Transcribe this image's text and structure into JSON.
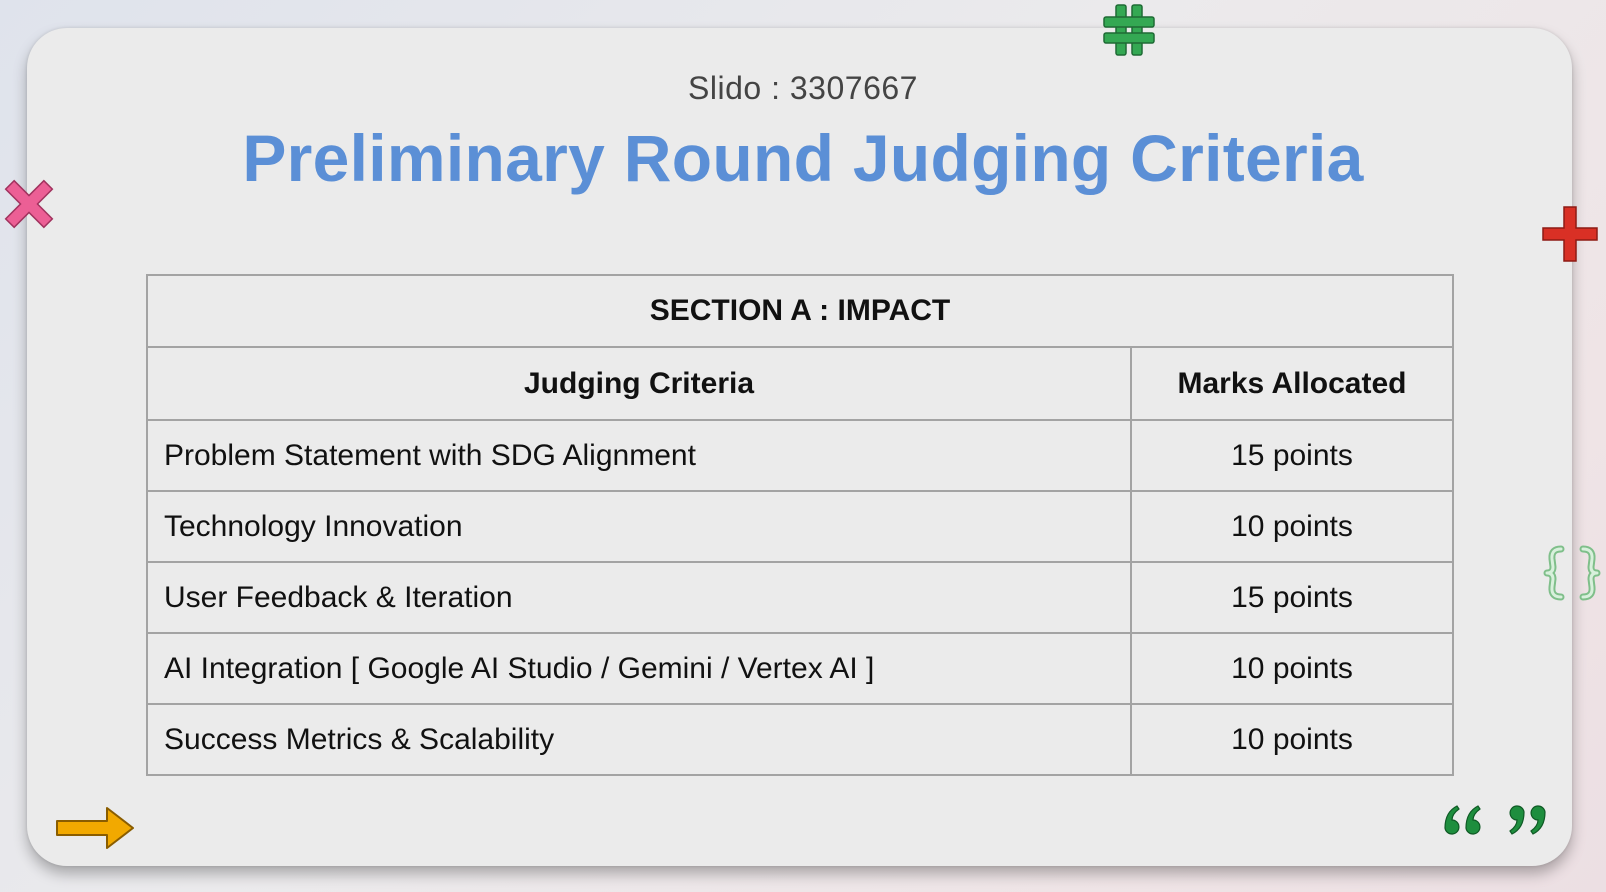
{
  "slide": {
    "subtitle": "Slido : 3307667",
    "title": "Preliminary Round Judging Criteria"
  },
  "table": {
    "section_heading": "SECTION A : IMPACT",
    "headers": {
      "criteria": "Judging Criteria",
      "marks": "Marks Allocated"
    },
    "rows": [
      {
        "criteria": "Problem Statement with SDG Alignment",
        "marks": "15 points"
      },
      {
        "criteria": "Technology Innovation",
        "marks": "10 points"
      },
      {
        "criteria": "User Feedback & Iteration",
        "marks": "15 points"
      },
      {
        "criteria": "AI Integration [ Google AI Studio / Gemini / Vertex AI ]",
        "marks": "10 points"
      },
      {
        "criteria": "Success Metrics & Scalability",
        "marks": "10 points"
      }
    ]
  },
  "decorations": {
    "icons": [
      "hashtag-icon",
      "x-mark-icon",
      "plus-icon",
      "curly-braces-icon",
      "arrow-right-icon",
      "quote-marks-icon"
    ],
    "colors": {
      "title": "#5b8fd6",
      "hashtag": "#34a853",
      "x_mark": "#ec5f95",
      "plus": "#d93025",
      "braces": "#bfe8c6",
      "arrow": "#f2a900",
      "quotes": "#1e8e3e"
    }
  }
}
